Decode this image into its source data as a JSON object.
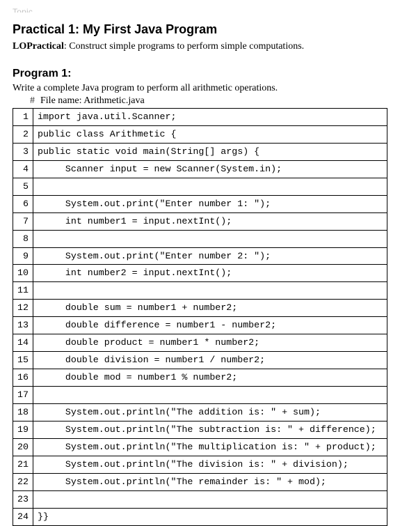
{
  "top_cut": "Topic ...",
  "title": "Practical 1: My First Java Program",
  "lo_label": "LOPractical",
  "lo_text": ": Construct simple programs to perform simple computations.",
  "program_heading": "Program 1:",
  "program_desc": "Write a complete Java program to perform all arithmetic operations.",
  "file_hash": "#",
  "file_line": "File name: Arithmetic.java",
  "code_lines": [
    {
      "n": "1",
      "t": "import java.util.Scanner;"
    },
    {
      "n": "2",
      "t": "public class Arithmetic {"
    },
    {
      "n": "3",
      "t": "public static void main(String[] args) {"
    },
    {
      "n": "4",
      "t": "     Scanner input = new Scanner(System.in);"
    },
    {
      "n": "5",
      "t": ""
    },
    {
      "n": "6",
      "t": "     System.out.print(\"Enter number 1: \");"
    },
    {
      "n": "7",
      "t": "     int number1 = input.nextInt();"
    },
    {
      "n": "8",
      "t": ""
    },
    {
      "n": "9",
      "t": "     System.out.print(\"Enter number 2: \");"
    },
    {
      "n": "10",
      "t": "     int number2 = input.nextInt();"
    },
    {
      "n": "11",
      "t": ""
    },
    {
      "n": "12",
      "t": "     double sum = number1 + number2;"
    },
    {
      "n": "13",
      "t": "     double difference = number1 - number2;"
    },
    {
      "n": "14",
      "t": "     double product = number1 * number2;"
    },
    {
      "n": "15",
      "t": "     double division = number1 / number2;"
    },
    {
      "n": "16",
      "t": "     double mod = number1 % number2;"
    },
    {
      "n": "17",
      "t": ""
    },
    {
      "n": "18",
      "t": "     System.out.println(\"The addition is: \" + sum);"
    },
    {
      "n": "19",
      "t": "     System.out.println(\"The subtraction is: \" + difference);"
    },
    {
      "n": "20",
      "t": "     System.out.println(\"The multiplication is: \" + product);"
    },
    {
      "n": "21",
      "t": "     System.out.println(\"The division is: \" + division);"
    },
    {
      "n": "22",
      "t": "     System.out.println(\"The remainder is: \" + mod);"
    },
    {
      "n": "23",
      "t": ""
    },
    {
      "n": "24",
      "t": "}}"
    }
  ]
}
